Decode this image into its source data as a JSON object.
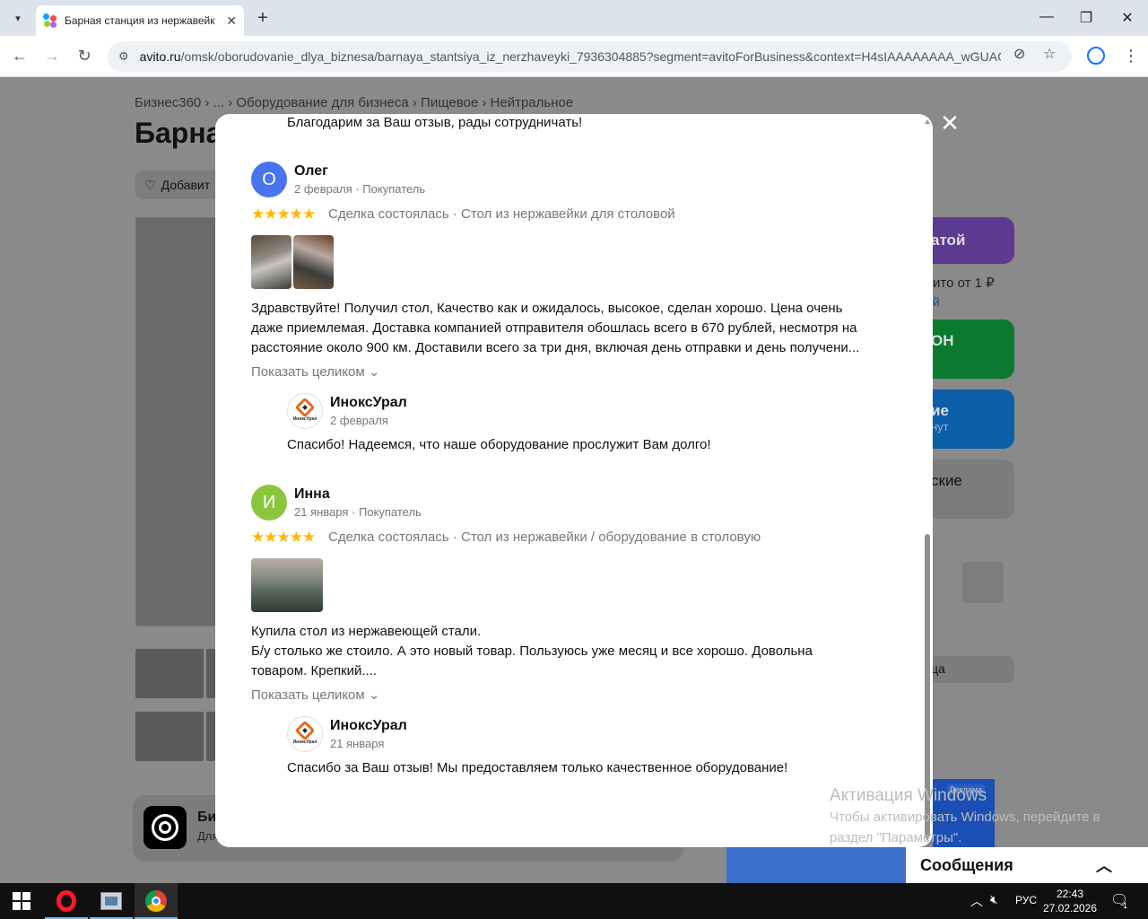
{
  "browser": {
    "tab_title": "Барная станция из нержавейки",
    "url_domain": "avito.ru",
    "url_path": "/omsk/oborudovanie_dlya_biznesa/barnaya_stantsiya_iz_nerzhaveyki_7936304885?segment=avitoForBusiness&context=H4sIAAAAAAAA_wGUAGv..."
  },
  "page": {
    "breadcrumbs": "Бизнес360 › ... › Оборудование для бизнеса › Пищевое › Нейтральное",
    "title_partial": "Барна",
    "fav_label": "Добавит",
    "side": {
      "btn1": "атой",
      "price_note": "ито от 1 ₽",
      "price_link": "й",
      "btn2": "ОН",
      "btn3": "ие",
      "btn3_sub": "нут",
      "btn4": "ские",
      "field": "ца"
    },
    "biz_card_title": "Би",
    "biz_card_sub": "Для",
    "ad_label": "Реклама",
    "messages": "Сообщения"
  },
  "modal": {
    "top_reply": "Благодарим за Ваш отзыв, рады сотрудничать!",
    "reviews": [
      {
        "initial": "О",
        "name": "Олег",
        "meta": "2 февраля · Покупатель",
        "stars": "★★★★★",
        "deal": "Сделка состоялась · Стол из нержавейки для столовой",
        "text": [
          "Здравствуйте! Получил стол, Качество как и ожидалось, высокое, сделан хорошо. Цена очень",
          "даже приемлемая. Доставка компанией отправителя обошлась всего в 670 рублей, несмотря на",
          "расстояние около 900 км. Доставили всего за три дня, включая день отправки и день получени..."
        ],
        "show_more": "Показать целиком ⌄",
        "reply_name": "ИноксУрал",
        "reply_date": "2 февраля",
        "reply_text": "Спасибо! Надеемся, что наше оборудование прослужит Вам долго!"
      },
      {
        "initial": "И",
        "name": "Инна",
        "meta": "21 января · Покупатель",
        "stars": "★★★★★",
        "deal": "Сделка состоялась · Стол из нержавейки / оборудование в столовую",
        "text": [
          "Купила стол из нержавеющей стали.",
          "Б/у столько же стоило. А это новый товар. Пользуюсь уже месяц и все хорошо. Довольна",
          "товаром. Крепкий...."
        ],
        "show_more": "Показать целиком ⌄",
        "reply_name": "ИноксУрал",
        "reply_date": "21 января",
        "reply_text": "Спасибо за Ваш отзыв! Мы предоставляем только качественное оборудование!"
      }
    ],
    "seller_logo_label": "ИноксУрал"
  },
  "activation": {
    "line1": "Активация Windows",
    "line2": "Чтобы активировать Windows, перейдите в",
    "line3": "раздел \"Параметры\"."
  },
  "taskbar": {
    "lang": "РУС",
    "time": "22:43",
    "date": "27.02.2026",
    "notif_count": "1"
  },
  "colors": {
    "avatar_oleg": "#4a73f0",
    "avatar_inna": "#8cc63f",
    "star": "#ffb800"
  }
}
